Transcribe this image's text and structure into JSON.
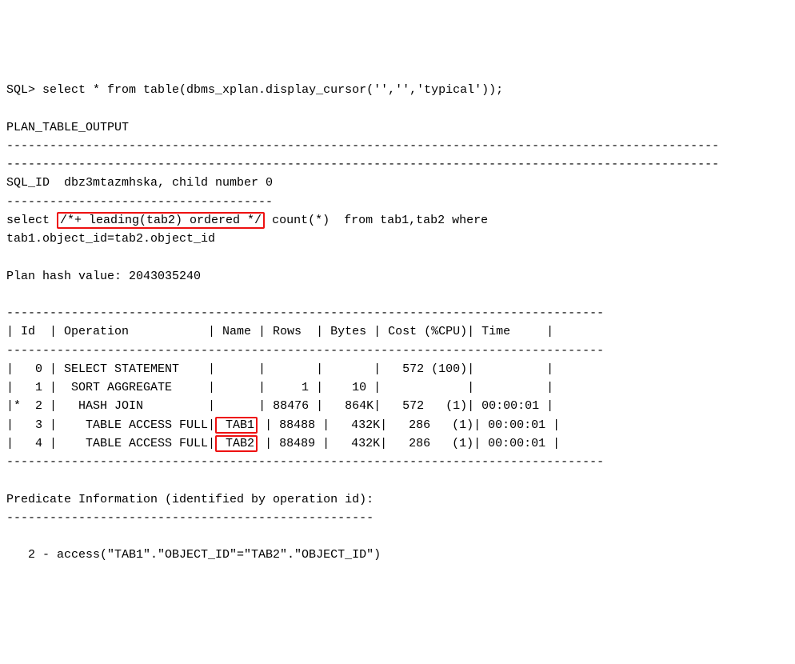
{
  "prompt": "SQL> ",
  "command": "select * from table(dbms_xplan.display_cursor('','','typical'));",
  "blank": "",
  "header_label": "PLAN_TABLE_OUTPUT",
  "dash_line_long": "---------------------------------------------------------------------------------------------------",
  "sql_id_line": "SQL_ID  dbz3mtazmhska, child number 0",
  "child_dashes": "-------------------------------------",
  "select_pre": "select ",
  "hint": "/*+ leading(tab2) ordered */",
  "select_post": " count(*)  from tab1,tab2 where",
  "select_line2": "tab1.object_id=tab2.object_id",
  "plan_hash_line": "Plan hash value: 2043035240",
  "plan_sep": "-----------------------------------------------------------------------------------",
  "plan_header": "| Id  | Operation           | Name | Rows  | Bytes | Cost (%CPU)| Time     |",
  "row0": "|   0 | SELECT STATEMENT    |      |       |       |   572 (100)|          |",
  "row1": "|   1 |  SORT AGGREGATE     |      |     1 |    10 |            |          |",
  "row2_pre": "|*  2 |   HASH JOIN         |",
  "row2_name": "     ",
  "row2_post": " | 88476 |   864K|   572   (1)| 00:00:01 |",
  "row3_pre": "|   3 |    TABLE ACCESS FULL|",
  "row3_name": " TAB1",
  "row3_post": " | 88488 |   432K|   286   (1)| 00:00:01 |",
  "row4_pre": "|   4 |    TABLE ACCESS FULL|",
  "row4_name": " TAB2",
  "row4_post": " | 88489 |   432K|   286   (1)| 00:00:01 |",
  "pred_header": "Predicate Information (identified by operation id):",
  "pred_dashes": "---------------------------------------------------",
  "pred_line": "   2 - access(\"TAB1\".\"OBJECT_ID\"=\"TAB2\".\"OBJECT_ID\")",
  "chart_data": {
    "type": "table",
    "title": "Execution Plan",
    "sql_id": "dbz3mtazmhska",
    "child_number": 0,
    "plan_hash_value": 2043035240,
    "columns": [
      "Id",
      "Operation",
      "Name",
      "Rows",
      "Bytes",
      "Cost (%CPU)",
      "Time"
    ],
    "rows": [
      {
        "Id": 0,
        "starred": false,
        "Operation": "SELECT STATEMENT",
        "Name": "",
        "Rows": null,
        "Bytes": null,
        "Cost": 572,
        "CPU_pct": 100,
        "Time": ""
      },
      {
        "Id": 1,
        "starred": false,
        "Operation": "SORT AGGREGATE",
        "Name": "",
        "Rows": 1,
        "Bytes": "10",
        "Cost": null,
        "CPU_pct": null,
        "Time": ""
      },
      {
        "Id": 2,
        "starred": true,
        "Operation": "HASH JOIN",
        "Name": "",
        "Rows": 88476,
        "Bytes": "864K",
        "Cost": 572,
        "CPU_pct": 1,
        "Time": "00:00:01"
      },
      {
        "Id": 3,
        "starred": false,
        "Operation": "TABLE ACCESS FULL",
        "Name": "TAB1",
        "Rows": 88488,
        "Bytes": "432K",
        "Cost": 286,
        "CPU_pct": 1,
        "Time": "00:00:01"
      },
      {
        "Id": 4,
        "starred": false,
        "Operation": "TABLE ACCESS FULL",
        "Name": "TAB2",
        "Rows": 88489,
        "Bytes": "432K",
        "Cost": 286,
        "CPU_pct": 1,
        "Time": "00:00:01"
      }
    ],
    "predicates": [
      {
        "id": 2,
        "type": "access",
        "condition": "\"TAB1\".\"OBJECT_ID\"=\"TAB2\".\"OBJECT_ID\""
      }
    ],
    "highlighted_hint": "/*+ leading(tab2) ordered */",
    "highlighted_names": [
      "TAB1",
      "TAB2"
    ]
  }
}
